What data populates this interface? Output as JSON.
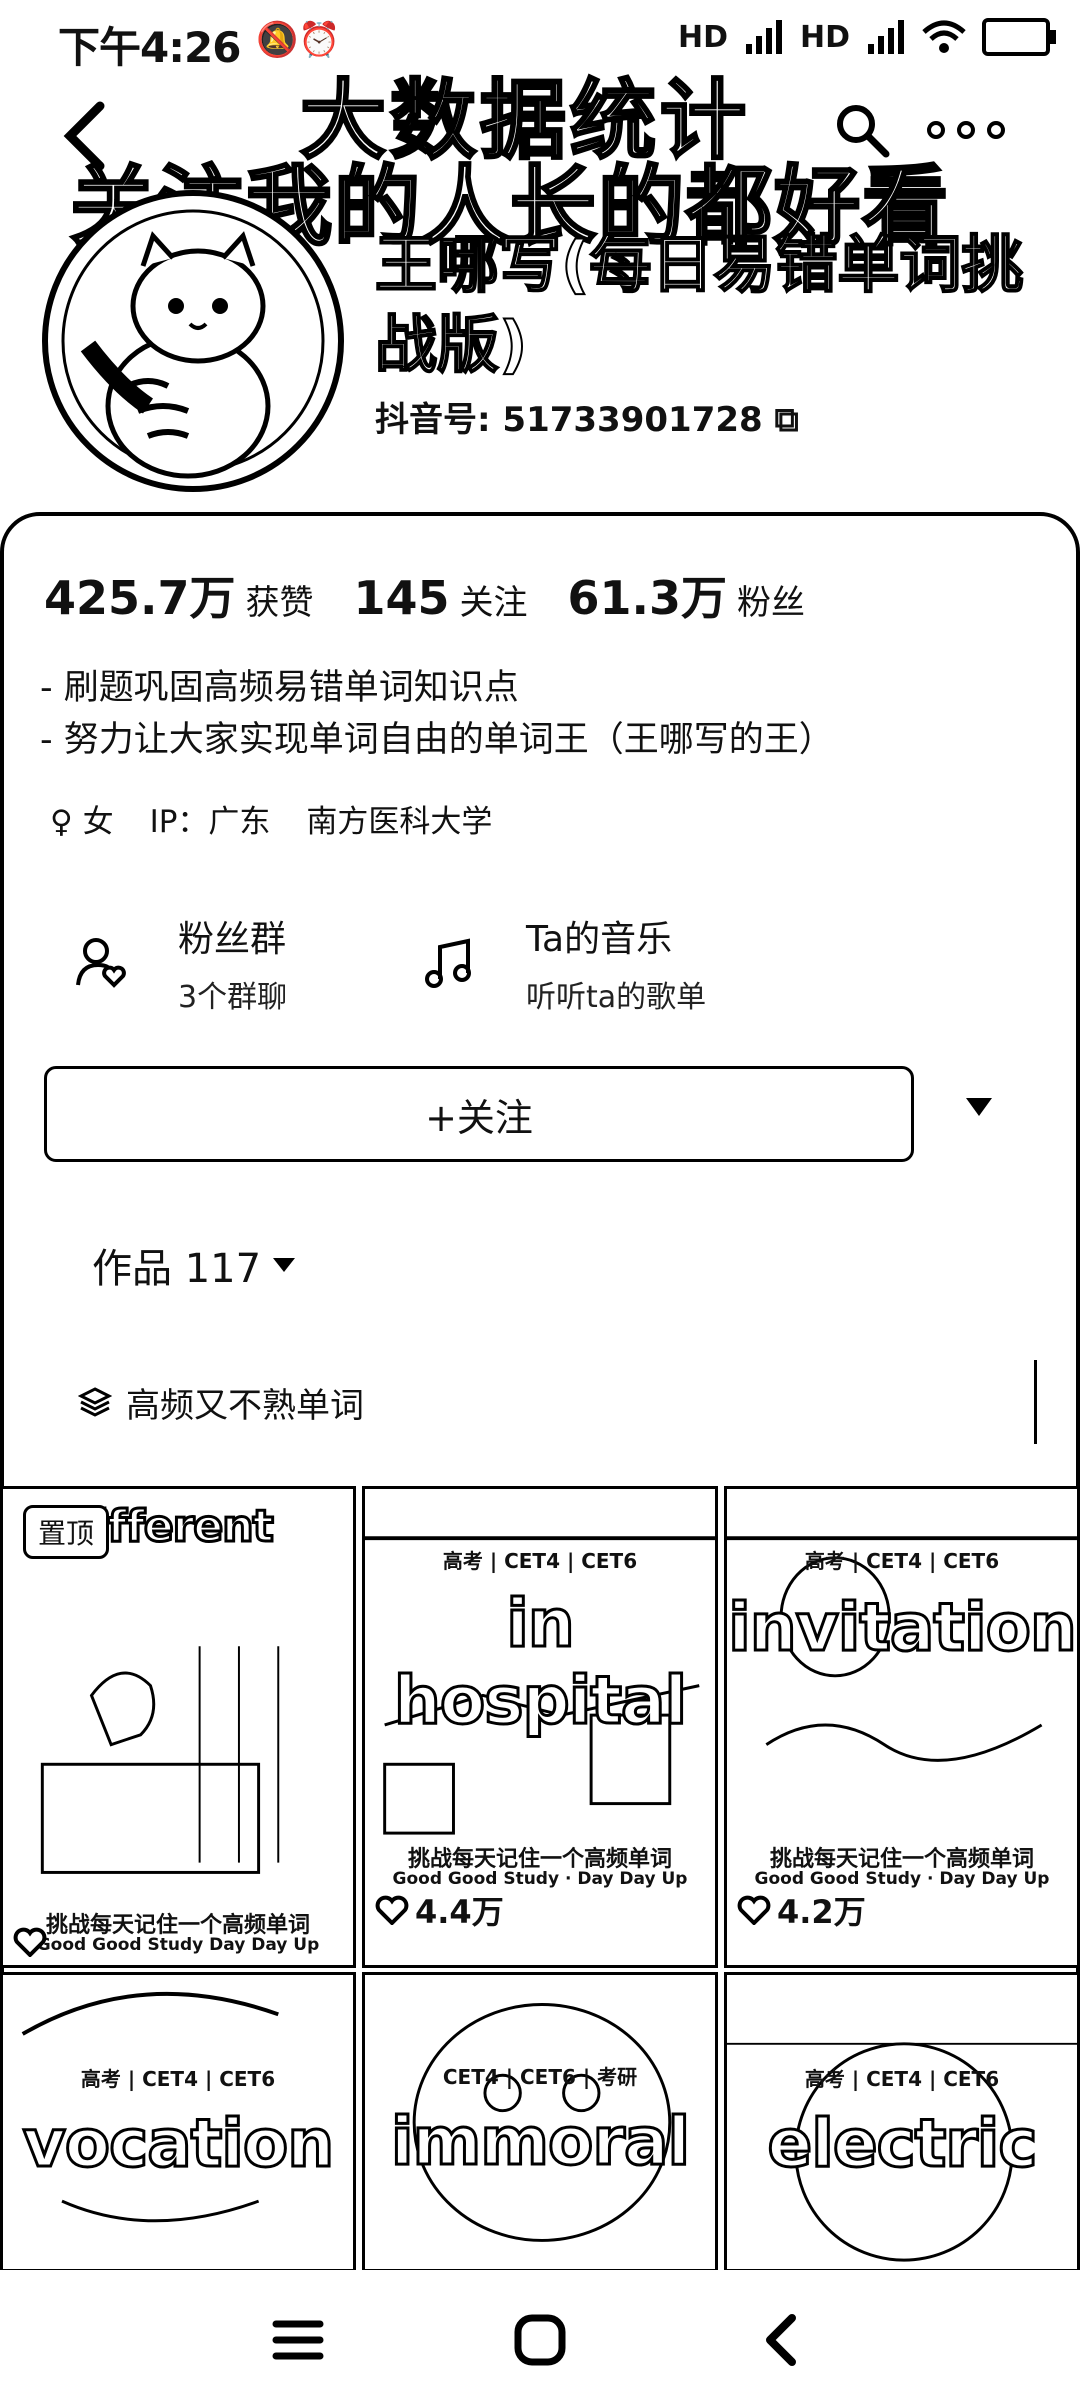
{
  "status_bar": {
    "time": "下午4:26",
    "network": [
      "HD",
      "HD"
    ]
  },
  "banner": {
    "line1": "大数据统计",
    "line2": "关注我的人长的都好看"
  },
  "profile": {
    "nickname": "王哪写(每日易错单词挑战版)",
    "douyin_id": "抖音号: 51733901728"
  },
  "stats": [
    {
      "num": "425.7万",
      "label": "获赞"
    },
    {
      "num": "145",
      "label": "关注"
    },
    {
      "num": "61.3万",
      "label": "粉丝"
    }
  ],
  "bio": [
    "- 刷题巩固高频易错单词知识点",
    "- 努力让大家实现单词自由的单词王（王哪写的王）"
  ],
  "meta": {
    "gender": "女",
    "ip": "IP：广东",
    "school": "南方医科大学"
  },
  "features": {
    "fan_group": {
      "title": "粉丝群",
      "sub": "3个群聊"
    },
    "music": {
      "title": "Ta的音乐",
      "sub": "听听ta的歌单"
    }
  },
  "follow_label": "+关注",
  "works_tab": "作品 117",
  "collection_label": "高频又不熟单词",
  "videos": [
    {
      "word": "different",
      "pinned": "置顶",
      "tags": "",
      "sub1": "挑战每天记住一个高频单词",
      "sub2": "Good Good Study Day Day Up",
      "likes": ""
    },
    {
      "word": "in hospital",
      "tags": "高考 | CET4 | CET6",
      "sub1": "挑战每天记住一个高频单词",
      "sub2": "Good Good Study · Day Day Up",
      "likes": "4.4万"
    },
    {
      "word": "invitation",
      "tags": "高考 | CET4 | CET6",
      "sub1": "挑战每天记住一个高频单词",
      "sub2": "Good Good Study · Day Day Up",
      "likes": "4.2万"
    },
    {
      "word": "vocation",
      "tags": "高考 | CET4 | CET6",
      "sub1": "",
      "sub2": "",
      "likes": ""
    },
    {
      "word": "immoral",
      "tags": "CET4 | CET6 | 考研",
      "sub1": "",
      "sub2": "",
      "likes": ""
    },
    {
      "word": "electric",
      "tags": "高考 | CET4 | CET6",
      "sub1": "",
      "sub2": "",
      "likes": ""
    }
  ]
}
